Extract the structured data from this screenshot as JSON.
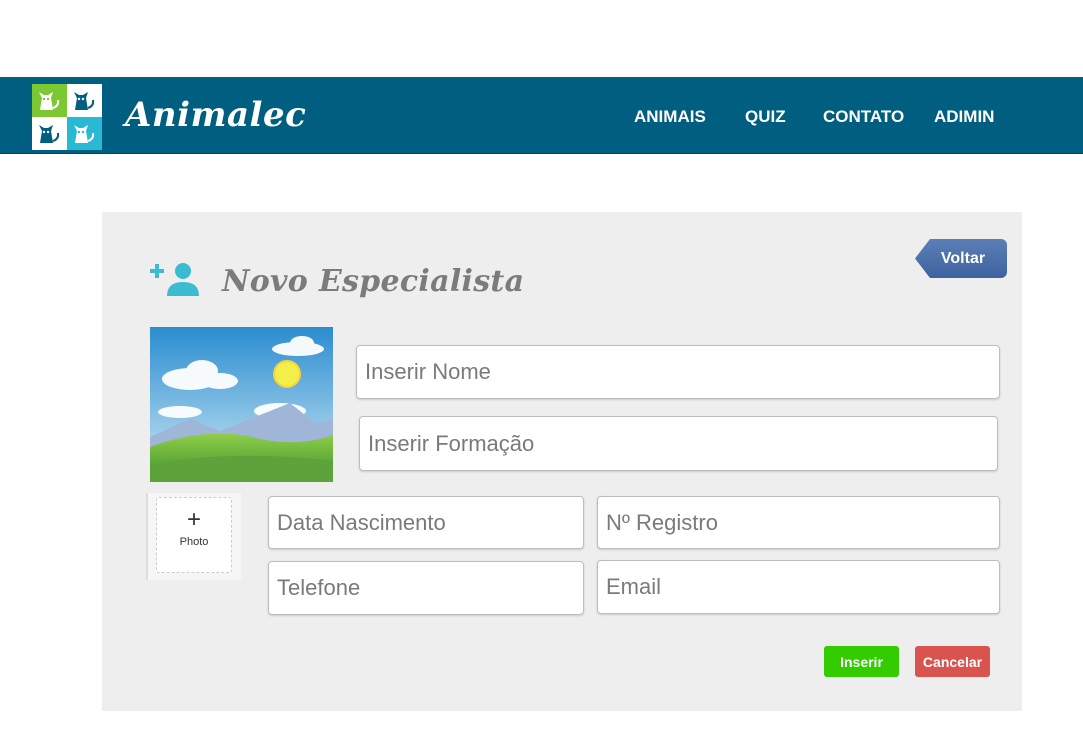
{
  "header": {
    "brand": "Animalec",
    "nav": [
      "ANIMAIS",
      "QUIZ",
      "CONTATO",
      "ADIMIN"
    ],
    "colors": {
      "bar": "#005e80",
      "logo_green": "#7cc832",
      "logo_cyan": "#29b9d4"
    }
  },
  "card": {
    "title": "Novo Especialista",
    "back_label": "Voltar",
    "upload_plus": "+",
    "upload_label": "Photo",
    "fields": {
      "nome": "Inserir Nome",
      "formacao": "Inserir Formação",
      "nascimento": "Data Nascimento",
      "registro": "Nº Registro",
      "telefone": "Telefone",
      "email": "Email"
    },
    "insert_label": "Inserir",
    "cancel_label": "Cancelar",
    "colors": {
      "card_bg": "#eeeeee",
      "back": "#4a6ea8",
      "insert": "#33cc00",
      "cancel": "#d9534f",
      "icon": "#3cbcd0"
    }
  },
  "icons": [
    "cat-icon",
    "add-user-icon",
    "landscape-placeholder-image"
  ]
}
